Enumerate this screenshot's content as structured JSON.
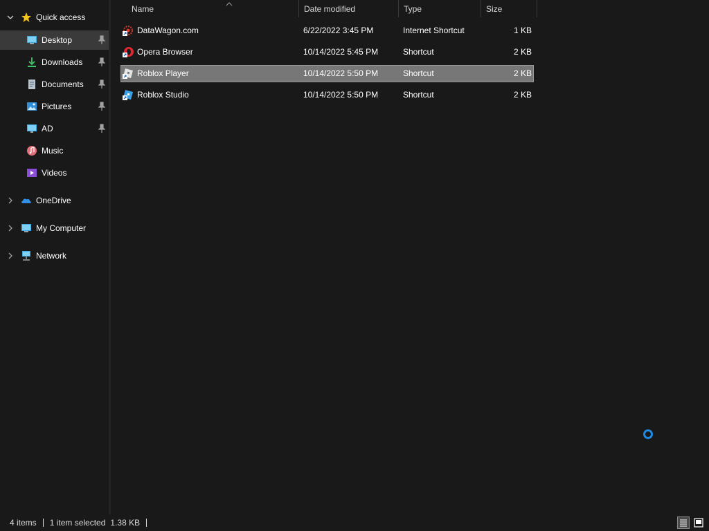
{
  "nav": {
    "quick_access": "Quick access",
    "items": [
      {
        "label": "Desktop",
        "icon": "desktop-icon",
        "pinned": true
      },
      {
        "label": "Downloads",
        "icon": "downloads-icon",
        "pinned": true
      },
      {
        "label": "Documents",
        "icon": "documents-icon",
        "pinned": true
      },
      {
        "label": "Pictures",
        "icon": "pictures-icon",
        "pinned": true
      },
      {
        "label": "AD",
        "icon": "monitor-icon",
        "pinned": true
      },
      {
        "label": "Music",
        "icon": "music-icon",
        "pinned": false
      },
      {
        "label": "Videos",
        "icon": "videos-icon",
        "pinned": false
      }
    ],
    "onedrive": "OneDrive",
    "my_computer": "My Computer",
    "network": "Network"
  },
  "columns": {
    "name": "Name",
    "date": "Date modified",
    "type": "Type",
    "size": "Size"
  },
  "files": [
    {
      "name": "DataWagon.com",
      "date": "6/22/2022 3:45 PM",
      "type": "Internet Shortcut",
      "size": "1 KB",
      "icon": "datawagon-icon",
      "selected": false
    },
    {
      "name": "Opera Browser",
      "date": "10/14/2022 5:45 PM",
      "type": "Shortcut",
      "size": "2 KB",
      "icon": "opera-icon",
      "selected": false
    },
    {
      "name": "Roblox Player",
      "date": "10/14/2022 5:50 PM",
      "type": "Shortcut",
      "size": "2 KB",
      "icon": "roblox-player-icon",
      "selected": true
    },
    {
      "name": "Roblox Studio",
      "date": "10/14/2022 5:50 PM",
      "type": "Shortcut",
      "size": "2 KB",
      "icon": "roblox-studio-icon",
      "selected": false
    }
  ],
  "status": {
    "item_count": "4 items",
    "selection": "1 item selected",
    "selection_size": "1.38 KB"
  },
  "colors": {
    "background": "#191919",
    "selected_row": "#777777",
    "accent": "#1e88e5"
  }
}
